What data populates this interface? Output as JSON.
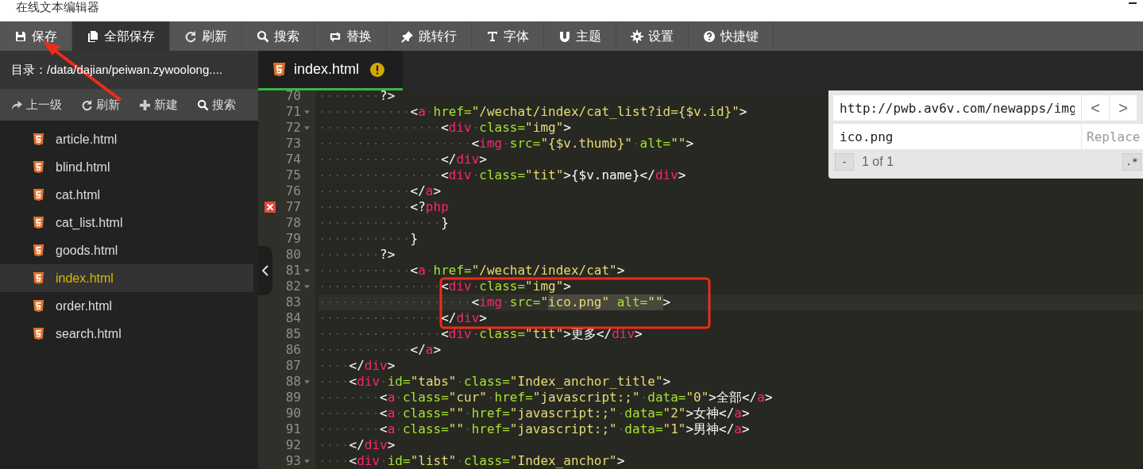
{
  "window": {
    "title": "在线文本编辑器"
  },
  "toolbar": [
    {
      "label": "保存",
      "active": false
    },
    {
      "label": "全部保存",
      "active": true
    },
    {
      "label": "刷新",
      "active": false
    },
    {
      "label": "搜索",
      "active": false
    },
    {
      "label": "替换",
      "active": false
    },
    {
      "label": "跳转行",
      "active": false
    },
    {
      "label": "字体",
      "active": false
    },
    {
      "label": "主题",
      "active": false
    },
    {
      "label": "设置",
      "active": false
    },
    {
      "label": "快捷键",
      "active": false
    }
  ],
  "sidebar": {
    "path": "目录：/data/dajian/peiwan.zywoolong....",
    "actions": [
      {
        "label": "上一级"
      },
      {
        "label": "刷新"
      },
      {
        "label": "新建"
      },
      {
        "label": "搜索"
      }
    ],
    "files": [
      {
        "name": "article.html",
        "selected": false
      },
      {
        "name": "blind.html",
        "selected": false
      },
      {
        "name": "cat.html",
        "selected": false
      },
      {
        "name": "cat_list.html",
        "selected": false
      },
      {
        "name": "goods.html",
        "selected": false
      },
      {
        "name": "index.html",
        "selected": true
      },
      {
        "name": "order.html",
        "selected": false
      },
      {
        "name": "search.html",
        "selected": false
      }
    ]
  },
  "tabs": [
    {
      "label": "index.html",
      "selected": true,
      "warning": true
    }
  ],
  "editor": {
    "lines": [
      {
        "no": "70",
        "fold": false,
        "error": false,
        "current": false,
        "tokens": [
          {
            "kind": "punct",
            "text": "        ?>"
          }
        ]
      },
      {
        "no": "71",
        "fold": true,
        "error": false,
        "current": false,
        "tokens": [
          {
            "kind": "punct",
            "text": "            <"
          },
          {
            "kind": "tag",
            "text": "a"
          },
          {
            "kind": "attr",
            "text": " href="
          },
          {
            "kind": "str",
            "text": "\"/wechat/index/cat_list?id={$v.id}\""
          },
          {
            "kind": "punct",
            "text": ">"
          }
        ]
      },
      {
        "no": "72",
        "fold": true,
        "error": false,
        "current": false,
        "tokens": [
          {
            "kind": "punct",
            "text": "                <"
          },
          {
            "kind": "tag",
            "text": "div"
          },
          {
            "kind": "attr",
            "text": " class="
          },
          {
            "kind": "str",
            "text": "\"img\""
          },
          {
            "kind": "punct",
            "text": ">"
          }
        ]
      },
      {
        "no": "73",
        "fold": false,
        "error": false,
        "current": false,
        "tokens": [
          {
            "kind": "punct",
            "text": "                    <"
          },
          {
            "kind": "tag",
            "text": "img"
          },
          {
            "kind": "attr",
            "text": " src="
          },
          {
            "kind": "str",
            "text": "\"{$v.thumb}\""
          },
          {
            "kind": "attr",
            "text": " alt="
          },
          {
            "kind": "str",
            "text": "\"\""
          },
          {
            "kind": "punct",
            "text": ">"
          }
        ]
      },
      {
        "no": "74",
        "fold": false,
        "error": false,
        "current": false,
        "tokens": [
          {
            "kind": "punct",
            "text": "                </"
          },
          {
            "kind": "tag",
            "text": "div"
          },
          {
            "kind": "punct",
            "text": ">"
          }
        ]
      },
      {
        "no": "75",
        "fold": false,
        "error": false,
        "current": false,
        "tokens": [
          {
            "kind": "punct",
            "text": "                <"
          },
          {
            "kind": "tag",
            "text": "div"
          },
          {
            "kind": "attr",
            "text": " class="
          },
          {
            "kind": "str",
            "text": "\"tit\""
          },
          {
            "kind": "punct",
            "text": ">{$v.name}</"
          },
          {
            "kind": "tag",
            "text": "div"
          },
          {
            "kind": "punct",
            "text": ">"
          }
        ]
      },
      {
        "no": "76",
        "fold": false,
        "error": false,
        "current": false,
        "tokens": [
          {
            "kind": "punct",
            "text": "            </"
          },
          {
            "kind": "tag",
            "text": "a"
          },
          {
            "kind": "punct",
            "text": ">"
          }
        ]
      },
      {
        "no": "77",
        "fold": false,
        "error": true,
        "current": false,
        "tokens": [
          {
            "kind": "punct",
            "text": "            <?"
          },
          {
            "kind": "tag",
            "text": "php"
          }
        ]
      },
      {
        "no": "78",
        "fold": false,
        "error": false,
        "current": false,
        "tokens": [
          {
            "kind": "punct",
            "text": "                }"
          }
        ]
      },
      {
        "no": "79",
        "fold": false,
        "error": false,
        "current": false,
        "tokens": [
          {
            "kind": "punct",
            "text": "            }"
          }
        ]
      },
      {
        "no": "80",
        "fold": false,
        "error": false,
        "current": false,
        "tokens": [
          {
            "kind": "punct",
            "text": "        ?>"
          }
        ]
      },
      {
        "no": "81",
        "fold": true,
        "error": false,
        "current": false,
        "tokens": [
          {
            "kind": "punct",
            "text": "            <"
          },
          {
            "kind": "tag",
            "text": "a"
          },
          {
            "kind": "attr",
            "text": " href="
          },
          {
            "kind": "str",
            "text": "\"/wechat/index/cat\""
          },
          {
            "kind": "punct",
            "text": ">"
          }
        ]
      },
      {
        "no": "82",
        "fold": true,
        "error": false,
        "current": false,
        "tokens": [
          {
            "kind": "punct",
            "text": "                <"
          },
          {
            "kind": "tag",
            "text": "div"
          },
          {
            "kind": "attr",
            "text": " class="
          },
          {
            "kind": "str",
            "text": "\"img\""
          },
          {
            "kind": "punct",
            "text": ">"
          }
        ]
      },
      {
        "no": "83",
        "fold": false,
        "error": false,
        "current": true,
        "tokens": [
          {
            "kind": "punct",
            "text": "                    <",
            "selected": false
          },
          {
            "kind": "tag",
            "text": "img",
            "selected": false
          },
          {
            "kind": "attr",
            "text": " src=",
            "selected": false
          },
          {
            "kind": "str",
            "text": "\"",
            "selected": false
          },
          {
            "kind": "str",
            "text": "ico.png\"",
            "selected": true
          },
          {
            "kind": "attr",
            "text": " alt=",
            "selected": true
          },
          {
            "kind": "str",
            "text": "\"\"",
            "selected": true
          },
          {
            "kind": "punct",
            "text": ">",
            "selected": false
          }
        ]
      },
      {
        "no": "84",
        "fold": false,
        "error": false,
        "current": false,
        "tokens": [
          {
            "kind": "punct",
            "text": "                </"
          },
          {
            "kind": "tag",
            "text": "div"
          },
          {
            "kind": "punct",
            "text": ">"
          }
        ]
      },
      {
        "no": "85",
        "fold": false,
        "error": false,
        "current": false,
        "tokens": [
          {
            "kind": "punct",
            "text": "                <"
          },
          {
            "kind": "tag",
            "text": "div"
          },
          {
            "kind": "attr",
            "text": " class="
          },
          {
            "kind": "str",
            "text": "\"tit\""
          },
          {
            "kind": "punct",
            "text": ">更多</"
          },
          {
            "kind": "tag",
            "text": "div"
          },
          {
            "kind": "punct",
            "text": ">"
          }
        ]
      },
      {
        "no": "86",
        "fold": false,
        "error": false,
        "current": false,
        "tokens": [
          {
            "kind": "punct",
            "text": "            </"
          },
          {
            "kind": "tag",
            "text": "a"
          },
          {
            "kind": "punct",
            "text": ">"
          }
        ]
      },
      {
        "no": "87",
        "fold": false,
        "error": false,
        "current": false,
        "tokens": [
          {
            "kind": "punct",
            "text": "    </"
          },
          {
            "kind": "tag",
            "text": "div"
          },
          {
            "kind": "punct",
            "text": ">"
          }
        ]
      },
      {
        "no": "88",
        "fold": true,
        "error": false,
        "current": false,
        "tokens": [
          {
            "kind": "punct",
            "text": "    <"
          },
          {
            "kind": "tag",
            "text": "div"
          },
          {
            "kind": "attr",
            "text": " id="
          },
          {
            "kind": "str",
            "text": "\"tabs\""
          },
          {
            "kind": "attr",
            "text": " class="
          },
          {
            "kind": "str",
            "text": "\"Index_anchor_title\""
          },
          {
            "kind": "punct",
            "text": ">"
          }
        ]
      },
      {
        "no": "89",
        "fold": false,
        "error": false,
        "current": false,
        "tokens": [
          {
            "kind": "punct",
            "text": "        <"
          },
          {
            "kind": "tag",
            "text": "a"
          },
          {
            "kind": "attr",
            "text": " class="
          },
          {
            "kind": "str",
            "text": "\"cur\""
          },
          {
            "kind": "attr",
            "text": " href="
          },
          {
            "kind": "str",
            "text": "\"javascript:;\""
          },
          {
            "kind": "attr",
            "text": " data="
          },
          {
            "kind": "str",
            "text": "\"0\""
          },
          {
            "kind": "punct",
            "text": ">全部</"
          },
          {
            "kind": "tag",
            "text": "a"
          },
          {
            "kind": "punct",
            "text": ">"
          }
        ]
      },
      {
        "no": "90",
        "fold": false,
        "error": false,
        "current": false,
        "tokens": [
          {
            "kind": "punct",
            "text": "        <"
          },
          {
            "kind": "tag",
            "text": "a"
          },
          {
            "kind": "attr",
            "text": " class="
          },
          {
            "kind": "str",
            "text": "\"\""
          },
          {
            "kind": "attr",
            "text": " href="
          },
          {
            "kind": "str",
            "text": "\"javascript:;\""
          },
          {
            "kind": "attr",
            "text": " data="
          },
          {
            "kind": "str",
            "text": "\"2\""
          },
          {
            "kind": "punct",
            "text": ">女神</"
          },
          {
            "kind": "tag",
            "text": "a"
          },
          {
            "kind": "punct",
            "text": ">"
          }
        ]
      },
      {
        "no": "91",
        "fold": false,
        "error": false,
        "current": false,
        "tokens": [
          {
            "kind": "punct",
            "text": "        <"
          },
          {
            "kind": "tag",
            "text": "a"
          },
          {
            "kind": "attr",
            "text": " class="
          },
          {
            "kind": "str",
            "text": "\"\""
          },
          {
            "kind": "attr",
            "text": " href="
          },
          {
            "kind": "str",
            "text": "\"javascript:;\""
          },
          {
            "kind": "attr",
            "text": " data="
          },
          {
            "kind": "str",
            "text": "\"1\""
          },
          {
            "kind": "punct",
            "text": ">男神</"
          },
          {
            "kind": "tag",
            "text": "a"
          },
          {
            "kind": "punct",
            "text": ">"
          }
        ]
      },
      {
        "no": "92",
        "fold": false,
        "error": false,
        "current": false,
        "tokens": [
          {
            "kind": "punct",
            "text": "    </"
          },
          {
            "kind": "tag",
            "text": "div"
          },
          {
            "kind": "punct",
            "text": ">"
          }
        ]
      },
      {
        "no": "93",
        "fold": true,
        "error": false,
        "current": false,
        "tokens": [
          {
            "kind": "punct",
            "text": "    <"
          },
          {
            "kind": "tag",
            "text": "div"
          },
          {
            "kind": "attr",
            "text": " id="
          },
          {
            "kind": "str",
            "text": "\"list\""
          },
          {
            "kind": "attr",
            "text": " class="
          },
          {
            "kind": "str",
            "text": "\"Index_anchor\""
          },
          {
            "kind": "punct",
            "text": ">"
          }
        ]
      }
    ]
  },
  "search_panel": {
    "find_value": "http://pwb.av6v.com/newapps/img",
    "prev_button": "<",
    "next_button": ">",
    "replace_value": "ico.png",
    "replace_placeholder": "Replace",
    "minus_button": "-",
    "count": "1 of 1",
    "regex_button": ".*"
  }
}
